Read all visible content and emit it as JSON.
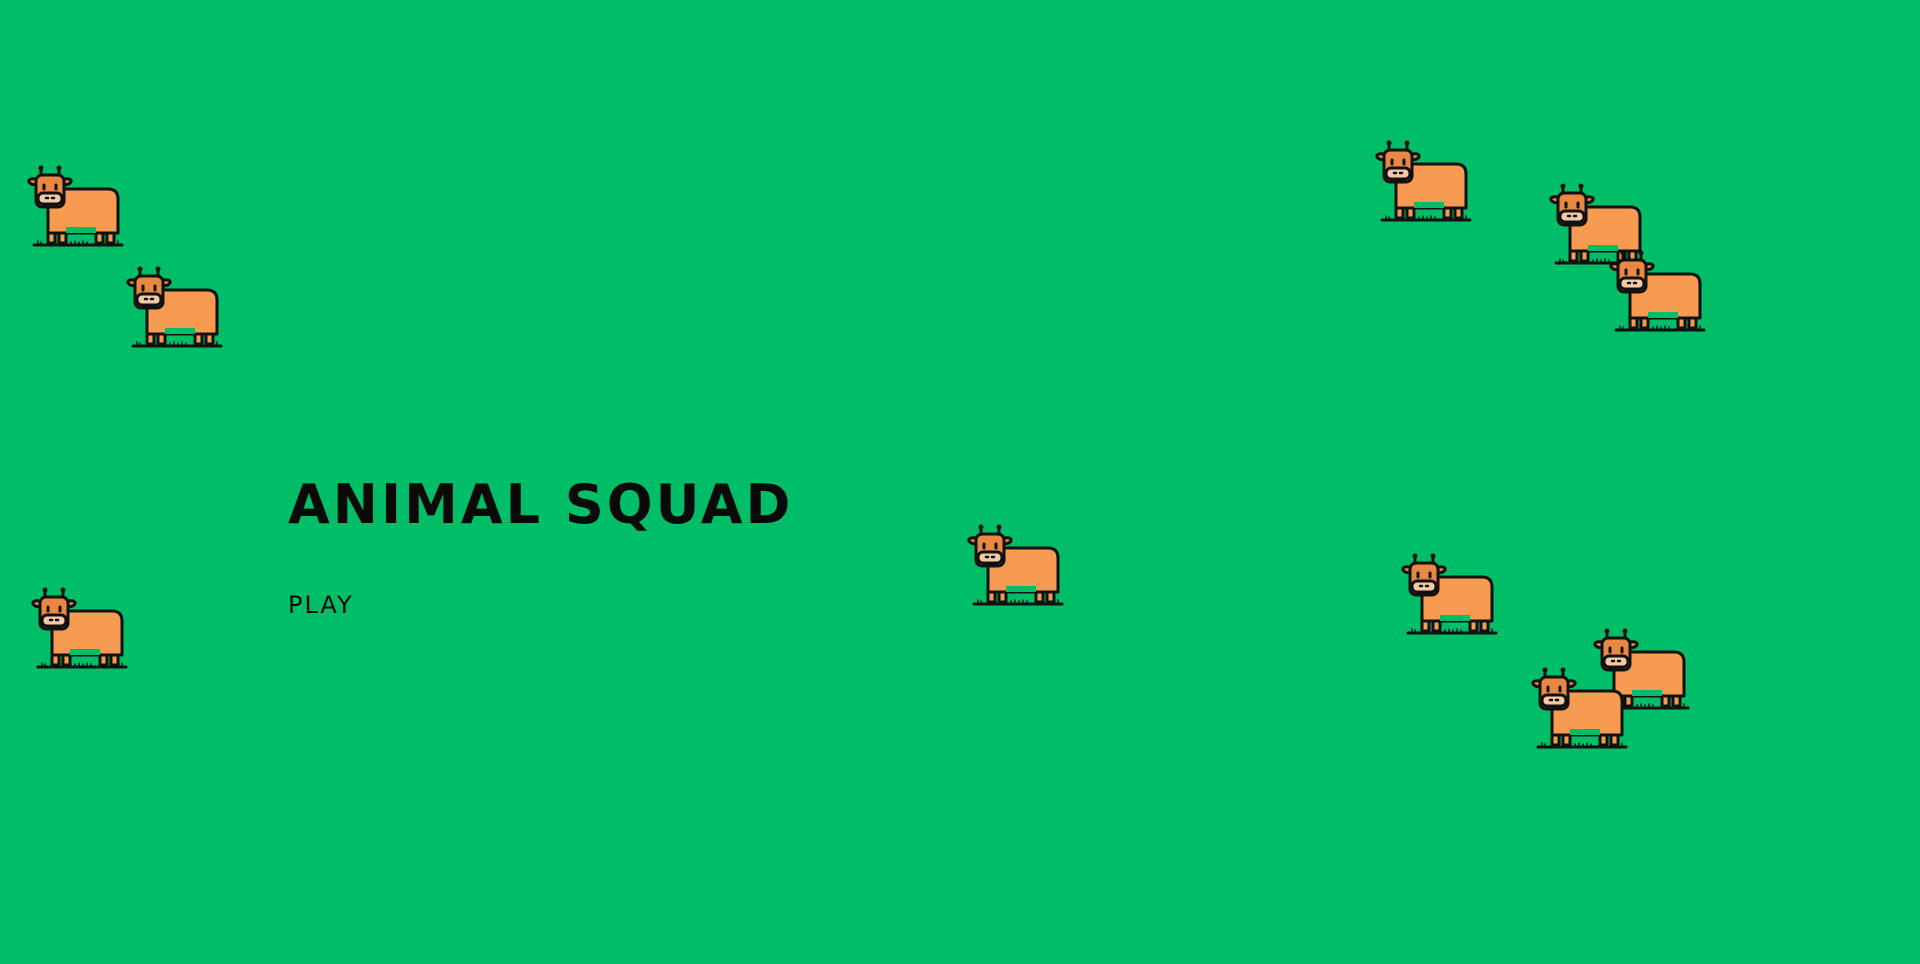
{
  "game": {
    "title": "ANIMAL SQUAD",
    "play_label": "PLAY"
  },
  "theme": {
    "background": "#00bd68",
    "cow_body": "#f79a52",
    "cow_head": "#e98843",
    "cow_snout": "#f6c9a6",
    "outline": "#111111"
  },
  "sprite": {
    "icon": "cow-icon",
    "count": 11
  }
}
